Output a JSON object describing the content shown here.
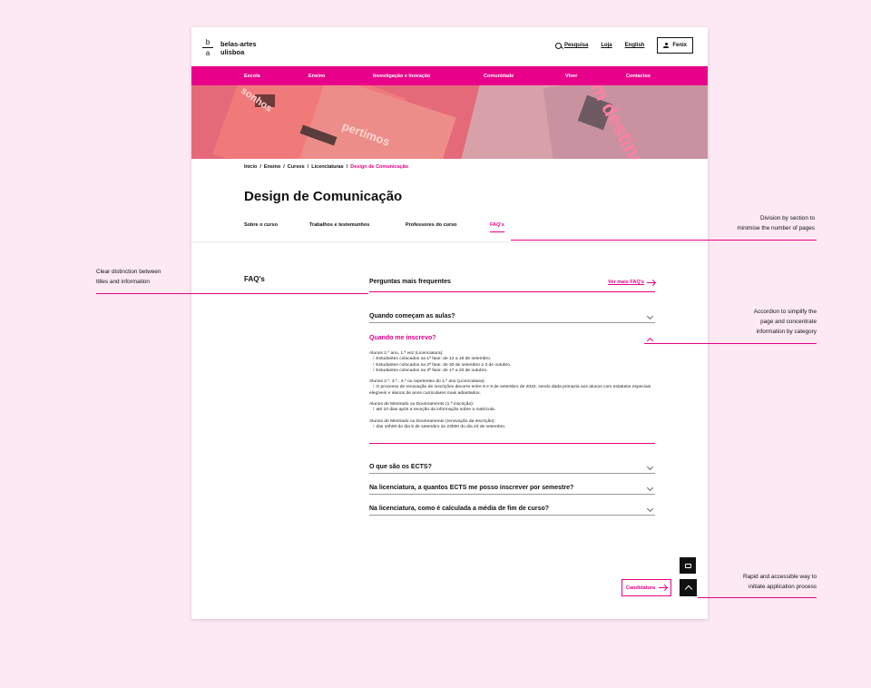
{
  "brand": {
    "mark_top": "b",
    "mark_bottom": "a",
    "line1": "belas-artes",
    "line2": "ulisboa"
  },
  "header": {
    "search": "Pesquisa",
    "shop": "Loja",
    "language": "English",
    "login": "Fenix"
  },
  "nav": [
    "Escola",
    "Ensino",
    "Investigação e Inovação",
    "Comunidade",
    "Viver",
    "Contactos"
  ],
  "hero": {
    "w1": "pertimos",
    "w2": "sem destino",
    "w3": "sonhos"
  },
  "breadcrumb": [
    "Início",
    "Ensino",
    "Cursos",
    "Licenciaturas",
    "Design de Comunicação"
  ],
  "page_title": "Design de Comunicação",
  "tabs": [
    "Sobre o curso",
    "Trabalhos e testemunhos",
    "Professores do curso",
    "FAQ's"
  ],
  "faq": {
    "section_title": "FAQ's",
    "header_title": "Perguntas mais frequentes",
    "see_more": "Ver mais FAQ's",
    "q1": "Quando começam as aulas?",
    "q2": "Quando me inscrevo?",
    "answer": {
      "p1_title": "Alunos 1.º ano, 1.ª vez (Licenciatura):",
      "p1_l1": "Estudantes colocados na 1ª fase: de 12 a 16 de setembro.",
      "p1_l2": "Estudantes colocados na 2ª fase: de 30 de setembro a 3 de outubro.",
      "p1_l3": "Estudantes colocados na 3ª fase: de 17 a 20 de outubro.",
      "p2_title": "Alunos 2.º, 3.º , 4.º ou repetentes do 1.º ano (Licenciatura):",
      "p2_l1": "O processo de renovação de inscrições decorre entre 5 e 9 de setembro de 2022, sendo dada primazia aos alunos com estatutos especiais elegíveis e alunos de anos curriculares mais adiantados.",
      "p3_title": "Alunos de Mestrado ou Doutoramento (1.ª inscrição):",
      "p3_l1": "até 10 dias após a receção da informação sobre a matrícula.",
      "p4_title": "Alunos de Mestrado ou Doutoramento (renovação da inscrição):",
      "p4_l1": "das 10h00 do dia 5 de setembro às 23h00 do dia 23 de setembro."
    },
    "q3": "O que são os ECTS?",
    "q4": "Na licenciatura, a quantos ECTS me posso inscrever por semestre?",
    "q5": "Na licenciatura, como é calculada a média de fim de curso?"
  },
  "candidatura": "Candidatura",
  "annotations": {
    "a1_l1": "Division by section to",
    "a1_l2": "minimise the number of pages",
    "a2_l1": "Clear distinction between",
    "a2_l2": "titles and information",
    "a3_l1": "Accordion to simplify the",
    "a3_l2": "page and concentrate",
    "a3_l3": "information by category",
    "a4_l1": "Rapid and accessible way to",
    "a4_l2": "initiate application process"
  },
  "colors": {
    "accent": "#e8008a",
    "background": "#fde9f3"
  }
}
